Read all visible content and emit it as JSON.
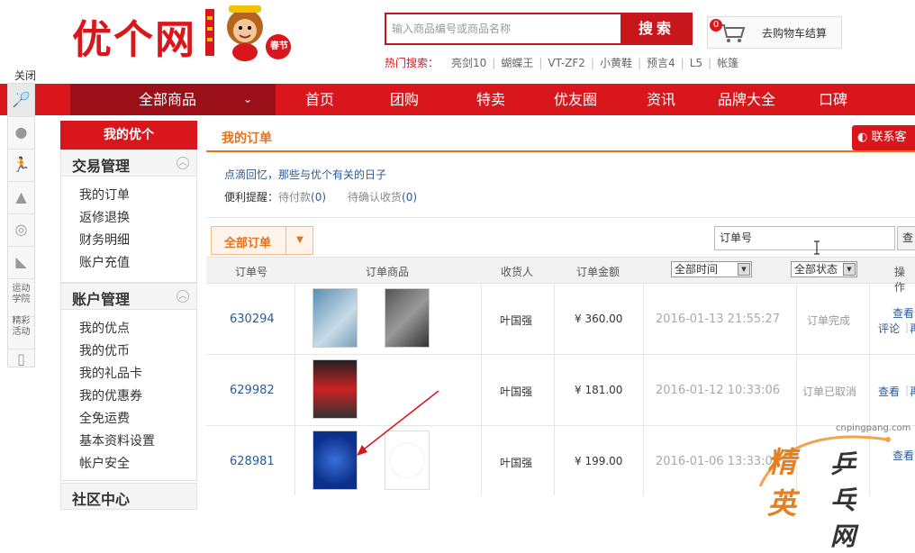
{
  "header": {
    "logo_text": "优个网",
    "logo_badge": "春节",
    "search_placeholder": "输入商品编号或商品名称",
    "search_button": "搜索",
    "cart_label": "去购物车结算",
    "cart_count": "0",
    "hot_label": "热门搜索：",
    "hot_keywords": [
      "亮剑10",
      "蝴蝶王",
      "VT-ZF2",
      "小黄鞋",
      "预言4",
      "L5",
      "帐篷"
    ]
  },
  "nav": {
    "all_products": "全部商品",
    "items": [
      "首页",
      "团购",
      "特卖",
      "优友圈",
      "资讯",
      "品牌大全",
      "口碑"
    ]
  },
  "iconbar": {
    "close": "关闭",
    "items": [
      "badminton-icon",
      "pingpong-icon",
      "running-icon",
      "tent-icon",
      "tennis-icon",
      "shoe-icon"
    ],
    "text_items": [
      "运动学院",
      "精彩活动"
    ],
    "phone": "phone-icon"
  },
  "sidebar": {
    "title": "我的优个",
    "sections": [
      {
        "title": "交易管理",
        "links": [
          "我的订单",
          "返修退换",
          "财务明细",
          "账户充值"
        ]
      },
      {
        "title": "账户管理",
        "links": [
          "我的优点",
          "我的优币",
          "我的礼品卡",
          "我的优惠券",
          "全免运费",
          "基本资料设置",
          "帐户安全"
        ]
      },
      {
        "title": "社区中心",
        "links": []
      }
    ]
  },
  "main": {
    "title": "我的订单",
    "contact": "联系客",
    "memory": "点滴回忆，那些与优个有关的日子",
    "remind_label": "便利提醒：",
    "pending_pay": "待付款",
    "pending_pay_count": "(0)",
    "pending_receipt": "待确认收货",
    "pending_receipt_count": "(0)",
    "tab_all": "全部订单",
    "order_search_value": "订单号",
    "order_search_btn": "查",
    "columns": {
      "order_no": "订单号",
      "goods": "订单商品",
      "receiver": "收货人",
      "amount": "订单金额",
      "time_filter": "全部时间",
      "status_filter": "全部状态",
      "ops": "操作"
    },
    "orders": [
      {
        "no": "630294",
        "receiver": "叶国强",
        "amount": "¥ 360.00",
        "time": "2016-01-13 21:55:27",
        "status": "订单完成",
        "op1": "查看",
        "op2": "评论",
        "op3": "再"
      },
      {
        "no": "629982",
        "receiver": "叶国强",
        "amount": "¥ 181.00",
        "time": "2016-01-12 10:33:06",
        "status": "订单已取消",
        "op1": "查看",
        "op2": "再",
        "op3": ""
      },
      {
        "no": "628981",
        "receiver": "叶国强",
        "amount": "¥ 199.00",
        "time": "2016-01-06 13:33:00",
        "status": "",
        "op1": "查看",
        "op2": "",
        "op3": ""
      }
    ]
  },
  "watermark": {
    "url": "cnpingpang.com",
    "text1": "精英",
    "text2": "乒乓网"
  }
}
